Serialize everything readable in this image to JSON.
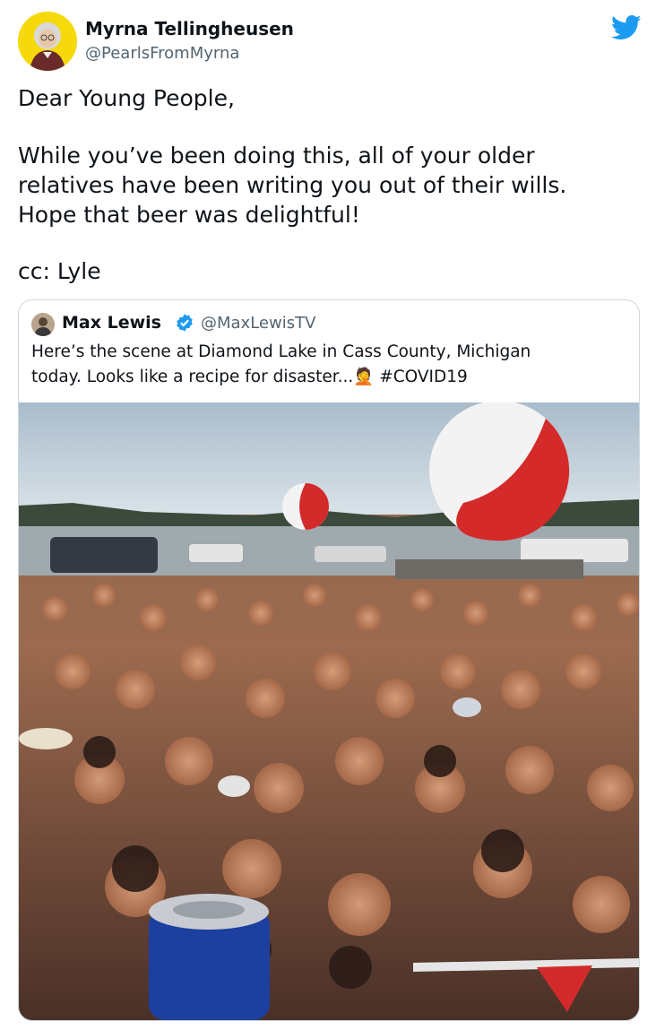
{
  "tweet": {
    "author_name": "Myrna Tellingheusen",
    "author_handle": "@PearlsFromMyrna",
    "avatar_icon": "person-avatar",
    "logo_icon": "twitter-bird-icon",
    "brand_color": "#1d9bf0",
    "lines": [
      "Dear Young People,",
      "While you’ve been doing this, all of your older",
      "relatives have been  writing you out of their wills.",
      "Hope that beer was delightful!",
      "cc: Lyle"
    ]
  },
  "quoted_tweet": {
    "author_name": "Max Lewis",
    "author_handle": "@MaxLewisTV",
    "verified_icon": "verified-badge-icon",
    "text_line_1": "Here’s the scene at Diamond Lake in Cass County, Michigan",
    "text_line_2": "today. Looks like a recipe for disaster...🤦 #COVID19",
    "media": "photo of a crowded lake party with beach balls"
  }
}
